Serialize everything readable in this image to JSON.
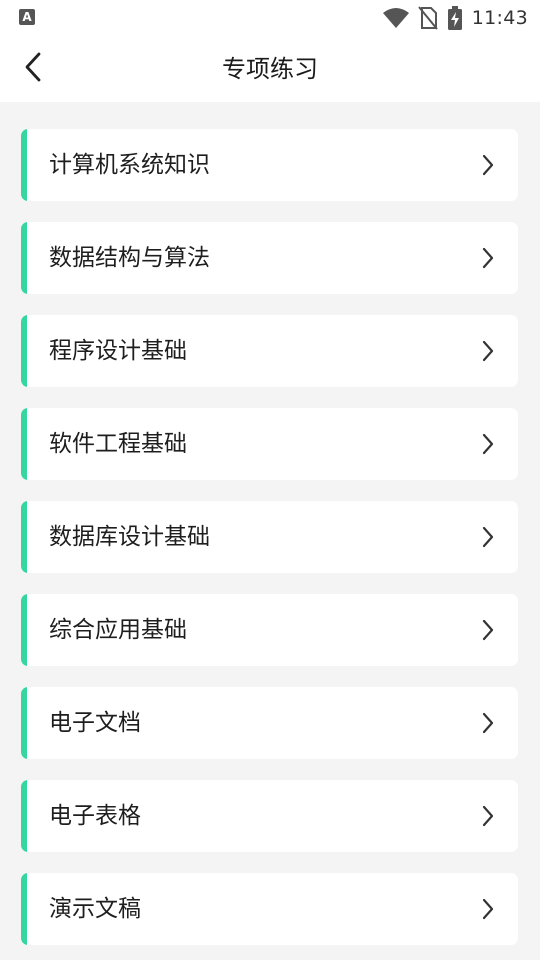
{
  "status_bar": {
    "notification_letter": "A",
    "time": "11:43",
    "icons": [
      "wifi-icon",
      "no-sim-icon",
      "battery-charging-icon"
    ]
  },
  "header": {
    "title": "专项练习",
    "back_icon": "chevron-left-icon"
  },
  "colors": {
    "accent": "#35d6a0",
    "background": "#f4f4f4",
    "card": "#ffffff"
  },
  "topics": [
    {
      "label": "计算机系统知识"
    },
    {
      "label": "数据结构与算法"
    },
    {
      "label": "程序设计基础"
    },
    {
      "label": "软件工程基础"
    },
    {
      "label": "数据库设计基础"
    },
    {
      "label": "综合应用基础"
    },
    {
      "label": "电子文档"
    },
    {
      "label": "电子表格"
    },
    {
      "label": "演示文稿"
    }
  ]
}
